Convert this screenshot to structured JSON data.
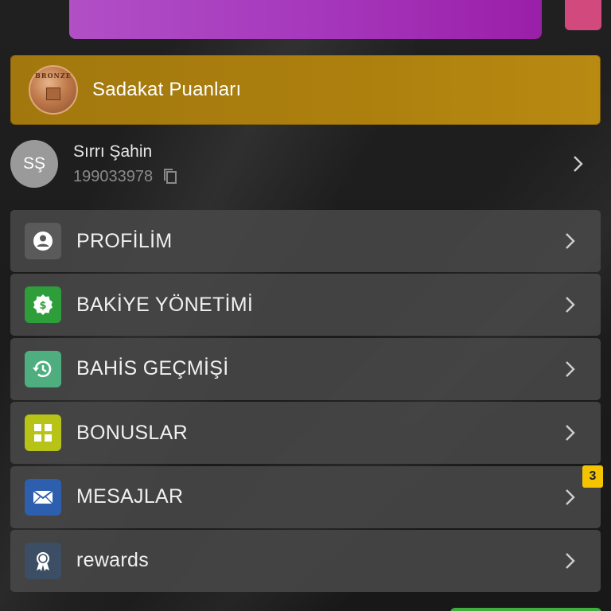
{
  "loyalty": {
    "label": "Sadakat Puanları",
    "medal_text": "BRONZE"
  },
  "user": {
    "initials": "SŞ",
    "name": "Sırrı Şahin",
    "id": "199033978"
  },
  "menu": {
    "items": [
      {
        "label": "PROFİLİM",
        "icon": "profile-icon",
        "color": "#5a5a5a"
      },
      {
        "label": "BAKİYE YÖNETİMİ",
        "icon": "balance-icon",
        "color": "#2e9e3a"
      },
      {
        "label": "BAHİS GEÇMİŞİ",
        "icon": "history-icon",
        "color": "#4fae80"
      },
      {
        "label": "BONUSLAR",
        "icon": "bonus-icon",
        "color": "#b7c417"
      },
      {
        "label": "MESAJLAR",
        "icon": "mail-icon",
        "color": "#2d5fae",
        "badge": "3"
      },
      {
        "label": "rewards",
        "icon": "rewards-icon",
        "color": "#3b4e63"
      }
    ]
  },
  "colors": {
    "loyalty_bg": "#a97d0f",
    "badge": "#f5c400",
    "promo": "#a639bd"
  }
}
